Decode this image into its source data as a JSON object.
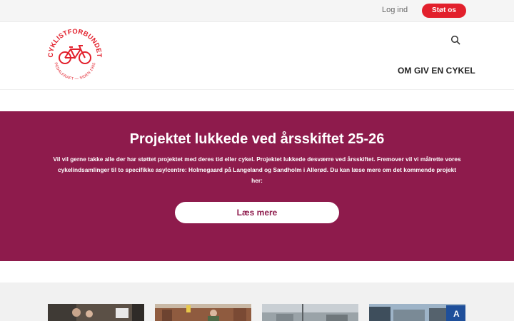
{
  "topbar": {
    "login_label": "Log ind",
    "support_label": "Støt os"
  },
  "header": {
    "logo_text_top": "CYKLISTFORBUNDET",
    "logo_text_bottom": "PEDALKRAFT — SIDEN 1905",
    "nav_label": "OM GIV EN CYKEL"
  },
  "banner": {
    "title": "Projektet lukkede ved årsskiftet 25-26",
    "body": "Vil vil gerne takke alle der har støttet projektet med deres tid eller cykel. Projektet lukkede desværre ved årsskiftet. Fremover vil vi målrette vores cykelindsamlinger til to specifikke asylcentre: Holmegaard på Langeland og Sandholm i Allerød. Du kan læse mere om det kommende projekt her:",
    "button_label": "Læs mere"
  },
  "colors": {
    "brand_red": "#e2202c",
    "banner_bg": "#8e1b4c"
  },
  "icons": {
    "search": "search-icon",
    "logo": "bicycle-logo-icon"
  }
}
